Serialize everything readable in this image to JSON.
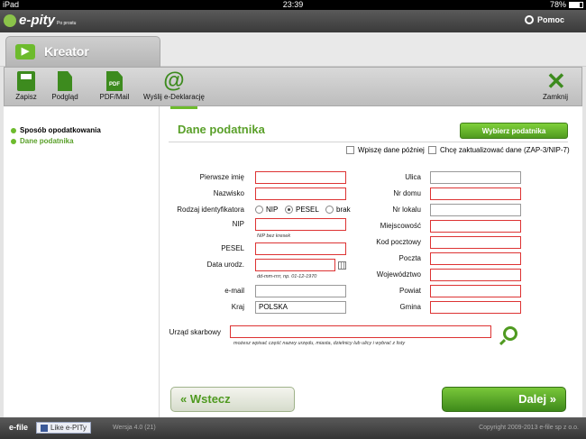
{
  "status_bar": {
    "device": "iPad",
    "time": "23:39",
    "battery": "78%",
    "battery_level": 0.78
  },
  "app": {
    "logo_name": "e-pity",
    "logo_tag": "Po prostu",
    "help_label": "Pomoc"
  },
  "wizard": {
    "title": "Kreator"
  },
  "toolbar": {
    "save": "Zapisz",
    "preview": "Podgląd",
    "pdf_mail": "PDF/Mail",
    "pdf_glyph": "PDF",
    "send": "Wyślij e-Deklarację",
    "close": "Zamknij"
  },
  "sidebar": {
    "items": [
      {
        "label": "Sposób opodatkowania"
      },
      {
        "label": "Dane podatnika"
      }
    ]
  },
  "form": {
    "section_title": "Dane podatnika",
    "pick_button": "Wybierz podatnika",
    "checkbox_later": "Wpiszę dane później",
    "checkbox_update": "Chcę zaktualizować dane (ZAP-3/NIP-7)",
    "left": {
      "first_name": "Pierwsze imię",
      "surname": "Nazwisko",
      "id_type": "Rodzaj identyfikatora",
      "id_options": [
        "NIP",
        "PESEL",
        "brak"
      ],
      "nip": "NIP",
      "nip_hint": "NIP bez kresek",
      "pesel": "PESEL",
      "birth_date": "Data urodz.",
      "birth_hint": "dd-mm-rrrr, np. 01-12-1970",
      "email": "e-mail",
      "country": "Kraj",
      "country_value": "POLSKA"
    },
    "right": {
      "street": "Ulica",
      "house_no": "Nr domu",
      "flat_no": "Nr lokalu",
      "city": "Miejscowość",
      "postal_code": "Kod pocztowy",
      "post": "Poczta",
      "voivodeship": "Województwo",
      "county": "Powiat",
      "commune": "Gmina"
    },
    "tax_office": "Urząd skarbowy",
    "tax_office_hint": "możesz wpisać część nazwy urzędu, miasta, dzielnicy lub ulicy i wybrać z listy",
    "back_button": "Wstecz",
    "next_button": "Dalej"
  },
  "footer": {
    "brand": "e-file",
    "like": "Like e-PITy",
    "version": "Wersja 4.0 (21)",
    "copyright": "Copyright 2009-2013 e-file sp z o.o."
  },
  "colors": {
    "accent": "#5aa02a",
    "error_border": "#dd3333"
  }
}
